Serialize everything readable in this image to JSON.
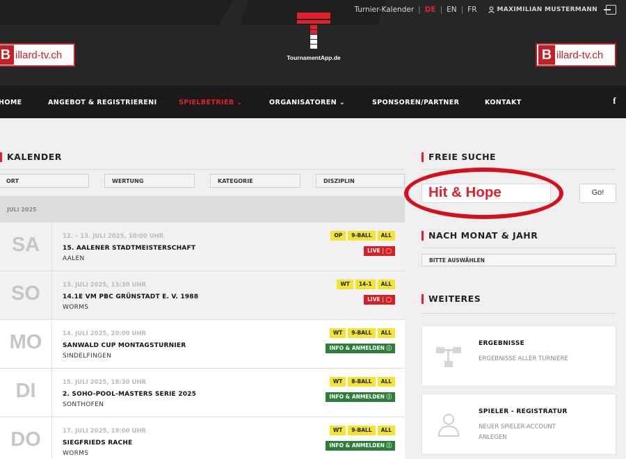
{
  "topbar": {
    "calendar": "Turnier-Kalender",
    "lang_de": "DE",
    "lang_en": "EN",
    "lang_fr": "FR",
    "user": "MAXIMILIAN MUSTERMANN",
    "sep": "|"
  },
  "logo": {
    "left_letter": "B",
    "left_text": "illard-tv.ch",
    "center_text": "TournamentApp.de"
  },
  "nav": {
    "home": "HOME",
    "angebot": "ANGEBOT & REGISTRIERENI",
    "spielbetrieb": "SPIELBETRIEB ⌄",
    "organisatoren": "ORGANISATOREN ⌄",
    "sponsoren": "SPONSOREN/PARTNER",
    "kontakt": "KONTAKT",
    "facebook": "f"
  },
  "calendar": {
    "title": "KALENDER",
    "filters": [
      "ORT",
      "WERTUNG",
      "KATEGORIE",
      "DISZIPLIN"
    ],
    "month": "JULI 2025",
    "events": [
      {
        "day": "SA",
        "date": "12. – 13. JULI 2025, 10:00 UHR",
        "name": "15. AALENER STADTMEISTERSCHAFT",
        "location": "AALEN",
        "tags": [
          "OP",
          "9-BALL",
          "ALL"
        ],
        "action": "LIVE | ◯",
        "action_type": "live"
      },
      {
        "day": "SO",
        "date": "13. JULI 2025, 13:30 UHR",
        "name": "14.1E VM PBC GRÜNSTADT E. V. 1988",
        "location": "WORMS",
        "tags": [
          "WT",
          "14-1",
          "ALL"
        ],
        "action": "LIVE | ◯",
        "action_type": "live"
      },
      {
        "day": "MO",
        "date": "14. JULI 2025, 20:00 UHR",
        "name": "SANWALD CUP MONTAGSTURNIER",
        "location": "SINDELFINGEN",
        "tags": [
          "WT",
          "9-BALL",
          "ALL"
        ],
        "action": "INFO & ANMELDEN ⓘ",
        "action_type": "info"
      },
      {
        "day": "DI",
        "date": "15. JULI 2025, 18:30 UHR",
        "name": "2. SOHO-POOL-MASTERS SERIE 2025",
        "location": "SONTHOFEN",
        "tags": [
          "WT",
          "8-BALL",
          "ALL"
        ],
        "action": "INFO & ANMELDEN ⓘ",
        "action_type": "info"
      },
      {
        "day": "DO",
        "date": "17. JULI 2025, 19:00 UHR",
        "name": "SIEGFRIEDS RACHE",
        "location": "WORMS",
        "tags": [
          "WT",
          "9-BALL",
          "ALL"
        ],
        "action": "INFO & ANMELDEN ⓘ",
        "action_type": "info"
      }
    ]
  },
  "sidebar": {
    "search_title": "FREIE SUCHE",
    "search_value": "Hit & Hope",
    "go": "Go!",
    "month_title": "NACH MONAT & JAHR",
    "month_select": "BITTE AUSWÄHLEN",
    "more_title": "WEITERES",
    "cards": [
      {
        "title": "ERGEBNISSE",
        "desc": "ERGEBNISSE ALLER TURNIERE",
        "icon": "sitemap-icon"
      },
      {
        "title": "SPIELER - REGISTRATUR",
        "desc": "NEUER SPIELER-ACCOUNT ANLEGEN",
        "icon": "user-icon"
      }
    ]
  },
  "colors": {
    "accent": "#e3202a",
    "header": "#262626",
    "nav": "#1a1a1a",
    "tag": "#f2e334",
    "live": "#d52027",
    "info": "#2f7d3a"
  }
}
